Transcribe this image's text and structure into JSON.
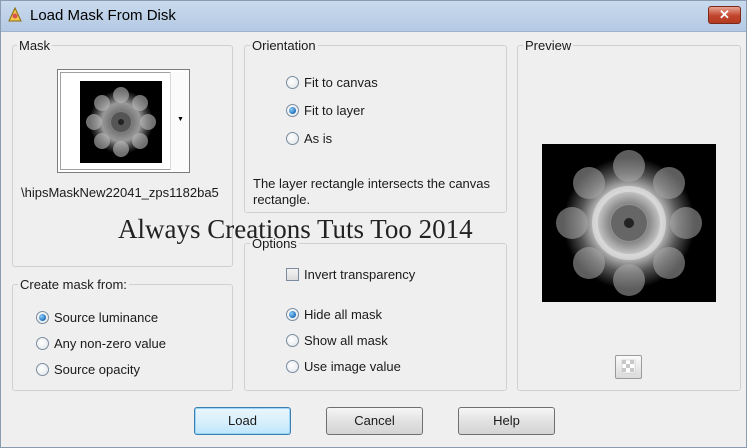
{
  "window": {
    "title": "Load Mask From Disk",
    "close_label": "✕"
  },
  "mask_group": {
    "legend": "Mask",
    "filename": "\\hipsMaskNew22041_zps1182ba5"
  },
  "orientation_group": {
    "legend": "Orientation",
    "options": [
      {
        "label": "Fit to canvas",
        "selected": false
      },
      {
        "label": "Fit to layer",
        "selected": true
      },
      {
        "label": "As is",
        "selected": false
      }
    ],
    "description": "The layer rectangle intersects the canvas rectangle."
  },
  "preview_group": {
    "legend": "Preview"
  },
  "create_group": {
    "legend": "Create mask from:",
    "options": [
      {
        "label": "Source luminance",
        "selected": true
      },
      {
        "label": "Any non-zero value",
        "selected": false
      },
      {
        "label": "Source opacity",
        "selected": false
      }
    ]
  },
  "options_group": {
    "legend": "Options",
    "invert_label": "Invert transparency",
    "invert_checked": false,
    "mask_options": [
      {
        "label": "Hide all mask",
        "selected": true
      },
      {
        "label": "Show all mask",
        "selected": false
      },
      {
        "label": "Use image value",
        "selected": false
      }
    ]
  },
  "watermark": "Always Creations Tuts Too 2014",
  "buttons": {
    "load": "Load",
    "cancel": "Cancel",
    "help": "Help"
  },
  "icons": {
    "app": "paint-shop-icon",
    "close": "close-icon",
    "preview_toggle": "checkerboard-icon",
    "dropdown": "chevron-down-icon"
  },
  "colors": {
    "accent": "#1d6fb8",
    "close": "#c2452d",
    "titlebar": "#c9daee"
  }
}
